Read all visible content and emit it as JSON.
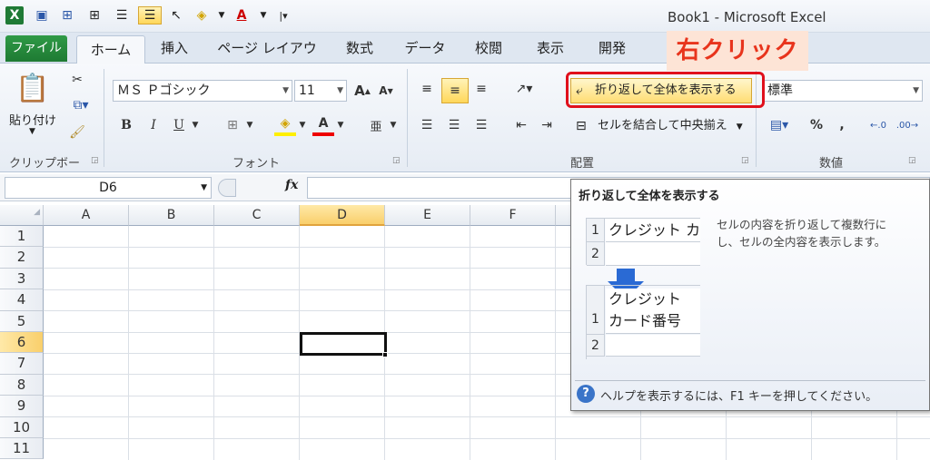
{
  "titlebar": {
    "title": "Book1  -  Microsoft Excel"
  },
  "tabs": {
    "file": "ファイル",
    "home": "ホーム",
    "insert": "挿入",
    "page_layout": "ページ レイアウト",
    "formulas": "数式",
    "data": "データ",
    "review": "校閲",
    "view": "表示",
    "developer": "開発"
  },
  "annotation": {
    "right_click": "右クリック"
  },
  "ribbon": {
    "clipboard": {
      "paste": "貼り付け",
      "group_label": "クリップボード"
    },
    "font": {
      "name": "ＭＳ Ｐゴシック",
      "size": "11",
      "group_label": "フォント"
    },
    "alignment": {
      "wrap_text": "折り返して全体を表示する",
      "merge_center": "セルを結合して中央揃え",
      "group_label": "配置"
    },
    "number": {
      "format": "標準",
      "group_label": "数値"
    }
  },
  "formula_bar": {
    "name_box": "D6",
    "fx": "fx"
  },
  "grid": {
    "columns": [
      "A",
      "B",
      "C",
      "D",
      "E",
      "F"
    ],
    "rows": [
      "1",
      "2",
      "3",
      "4",
      "5",
      "6",
      "7",
      "8",
      "9",
      "10",
      "11"
    ],
    "active_cell": "D6"
  },
  "tooltip": {
    "title": "折り返して全体を表示する",
    "desc_line1": "セルの内容を折り返して複数行に",
    "desc_line2": "し、セルの全内容を表示します。",
    "example_top_row1_num": "1",
    "example_top_row1_text": "クレジット カ",
    "example_top_row2_num": "2",
    "example_bottom_line1": "クレジット",
    "example_bottom_line2": "カード番号",
    "example_bottom_row1_num": "1",
    "example_bottom_row2_num": "2",
    "help": "ヘルプを表示するには、F1 キーを押してください。"
  }
}
